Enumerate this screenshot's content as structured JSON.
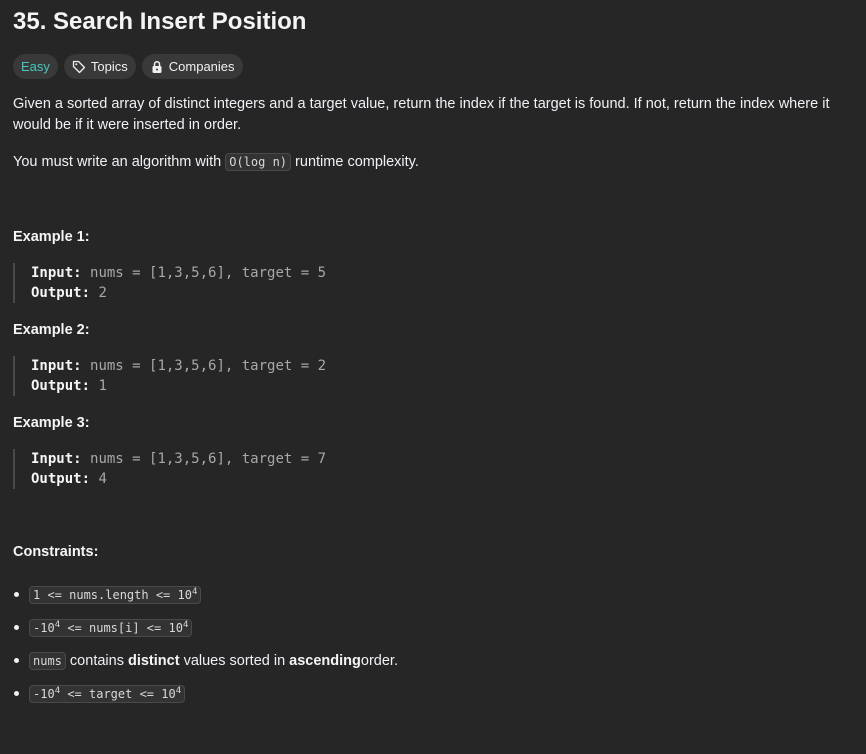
{
  "problem": {
    "title": "35. Search Insert Position",
    "difficulty": "Easy",
    "topics_label": "Topics",
    "companies_label": "Companies"
  },
  "description": {
    "p1": "Given a sorted array of distinct integers and a target value, return the index if the target is found. If not, return the index where it would be if it were inserted in order.",
    "p2_before": "You must write an algorithm with ",
    "p2_code": "O(log n)",
    "p2_after": " runtime complexity."
  },
  "examples": [
    {
      "heading": "Example 1:",
      "input_label": "Input:",
      "input": "nums = [1,3,5,6], target = 5",
      "output_label": "Output:",
      "output": "2"
    },
    {
      "heading": "Example 2:",
      "input_label": "Input:",
      "input": "nums = [1,3,5,6], target = 2",
      "output_label": "Output:",
      "output": "1"
    },
    {
      "heading": "Example 3:",
      "input_label": "Input:",
      "input": "nums = [1,3,5,6], target = 7",
      "output_label": "Output:",
      "output": "4"
    }
  ],
  "constraints": {
    "heading": "Constraints:",
    "c1": {
      "a": "1 <= nums.length <= 10",
      "a_sup": "4"
    },
    "c2": {
      "pre": "-10",
      "pre_sup": "4",
      "mid": " <= nums[i] <= 10",
      "mid_sup": "4"
    },
    "c3": {
      "code": "nums",
      "t1": " contains ",
      "b1": "distinct",
      "t2": " values sorted in ",
      "b2": "ascending",
      "t3": " order."
    },
    "c4": {
      "pre": "-10",
      "pre_sup": "4",
      "mid": " <= target <= 10",
      "mid_sup": "4"
    }
  },
  "colors": {
    "background": "#262626",
    "easy": "#46c6c2",
    "chip": "#393939"
  }
}
